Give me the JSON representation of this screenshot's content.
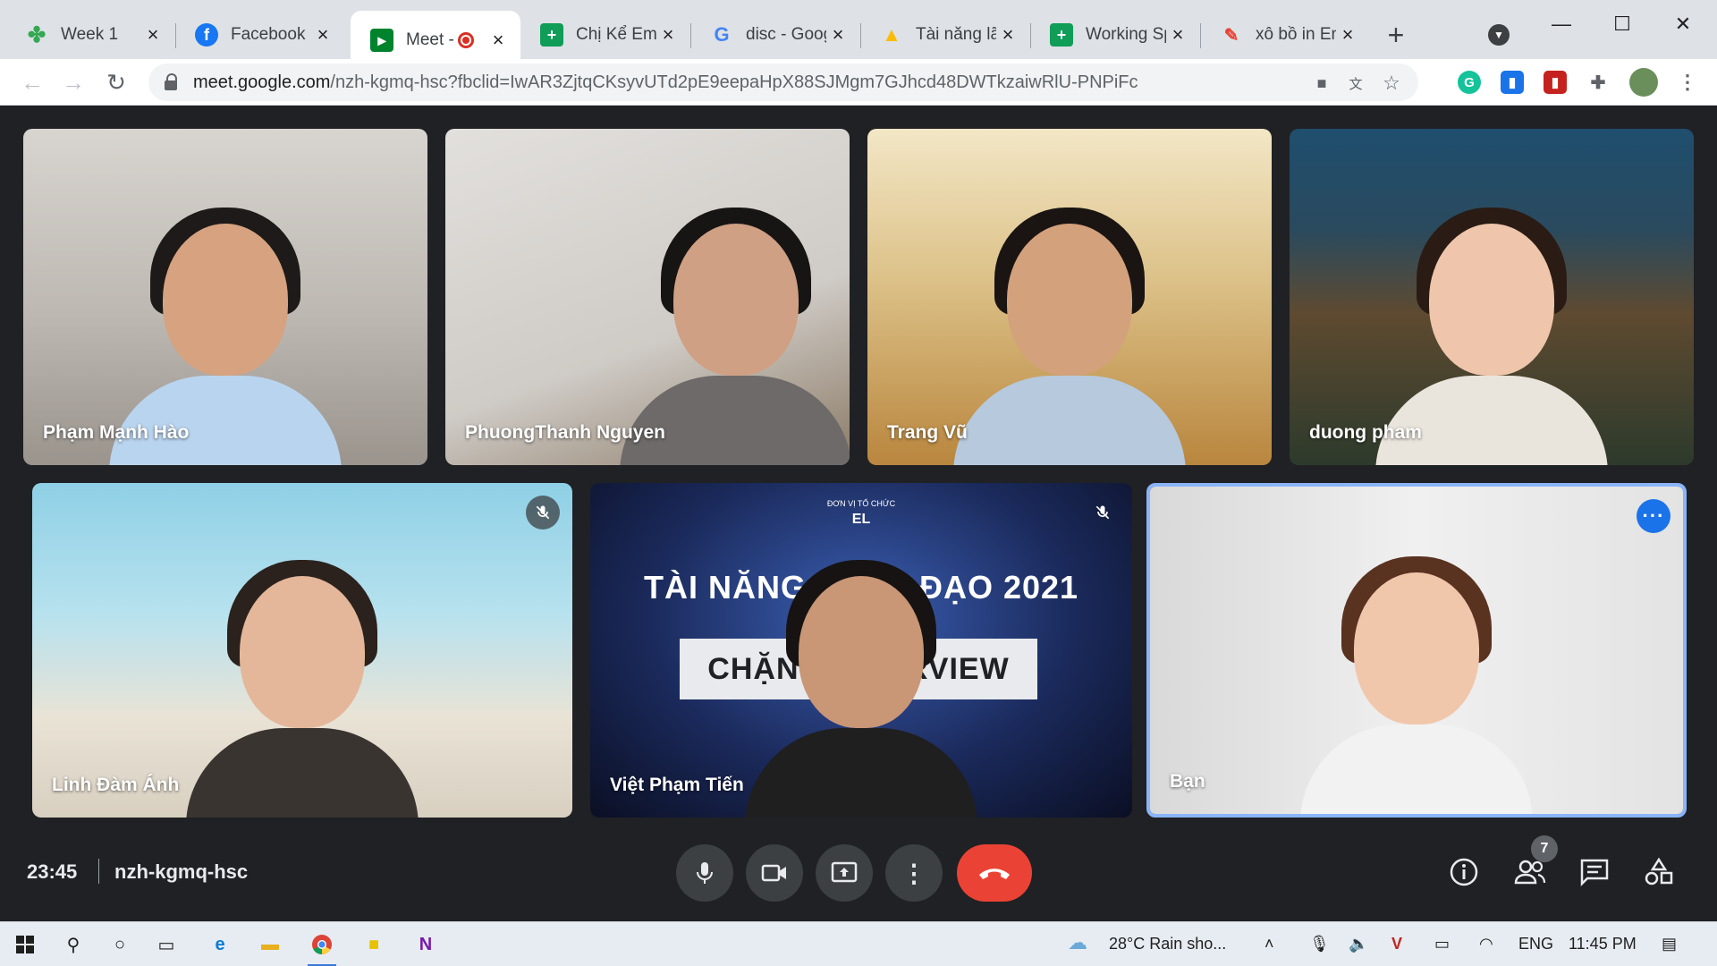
{
  "browser": {
    "tabs": [
      {
        "title": "Week 1",
        "favicon": "clover-icon",
        "color": "#34a853"
      },
      {
        "title": "Facebook",
        "favicon": "facebook-icon",
        "color": "#1877f2"
      },
      {
        "title": "Meet -",
        "favicon": "meet-icon",
        "color": "#00832d",
        "active": true,
        "recording": true
      },
      {
        "title": "Chị Kể Em N",
        "favicon": "sheets-icon",
        "color": "#0f9d58"
      },
      {
        "title": "disc - Goog",
        "favicon": "google-icon",
        "color": "#4285f4"
      },
      {
        "title": "Tài năng lãn",
        "favicon": "drive-icon",
        "color": "#fbbc04"
      },
      {
        "title": "Working Sp",
        "favicon": "sheets-icon",
        "color": "#0f9d58"
      },
      {
        "title": "xô bồ in Eng",
        "favicon": "translate-icon",
        "color": "#ea4335"
      }
    ],
    "url_host": "meet.google.com",
    "url_path": "/nzh-kgmq-hsc?fbclid=IwAR3ZjtqCKsyvUTd2pE9eepaHpX88SJMgm7GJhcd48DWTkzaiwRlU-PNPiFc"
  },
  "meeting": {
    "time": "23:45",
    "code": "nzh-kgmq-hsc",
    "participant_count": "7",
    "participants": [
      {
        "name": "Phạm Mạnh Hào",
        "muted": false,
        "bg": "#c9c5c0",
        "shirt": "#b9d4ee"
      },
      {
        "name": "PhuongThanh Nguyen",
        "muted": false,
        "bg": "#d6d3cf",
        "shirt": "#6d6a69"
      },
      {
        "name": "Trang Vũ",
        "muted": false,
        "bg": "#d9c08a",
        "shirt": "#b7c9dc"
      },
      {
        "name": "duong pham",
        "muted": false,
        "bg": "#2a4a5e",
        "shirt": "#e9e4dc"
      },
      {
        "name": "Linh Đàm Ánh",
        "muted": true,
        "bg": "#8fd0e6",
        "shirt": "#3a3430"
      },
      {
        "name": "Việt Phạm Tiến",
        "muted": true,
        "bg": "#1b2a5c",
        "shirt": "#1f1f1f"
      },
      {
        "name": "Bạn",
        "muted": false,
        "bg": "#e4e4e4",
        "shirt": "#f2f2f2",
        "self": true
      }
    ],
    "banner": {
      "org_label": "ĐƠN VỊ TỔ CHỨC",
      "org_name": "EL",
      "title": "TÀI NĂNG LÃNH ĐẠO 2021",
      "stage": "CHẶNG INTERVIEW"
    }
  },
  "taskbar": {
    "weather": "28°C  Rain sho...",
    "language": "ENG",
    "clock": "11:45 PM"
  }
}
